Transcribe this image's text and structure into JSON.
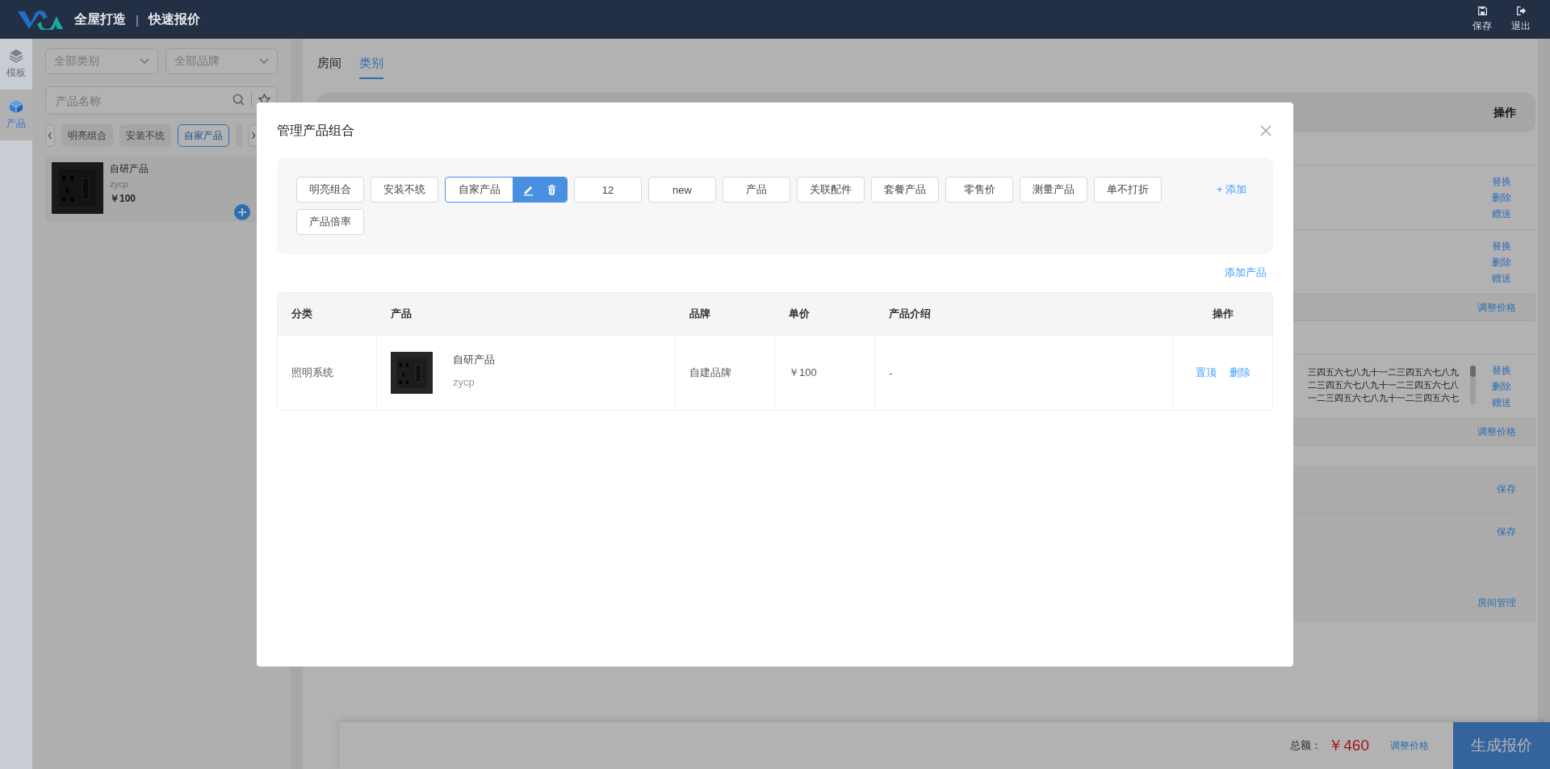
{
  "header": {
    "brand": "全屋打造",
    "separator": "|",
    "page_title": "快速报价",
    "actions": [
      {
        "kind": "save",
        "label": "保存"
      },
      {
        "kind": "exit",
        "label": "退出"
      }
    ]
  },
  "rail": [
    {
      "kind": "layers",
      "label": "模板",
      "selected": false
    },
    {
      "kind": "cube",
      "label": "产品",
      "selected": true
    }
  ],
  "product_panel": {
    "category_select": {
      "placeholder": "全部类别"
    },
    "brand_select": {
      "placeholder": "全部品牌"
    },
    "search": {
      "placeholder": "产品名称"
    },
    "groups": [
      {
        "label": "明亮组合",
        "selected": false
      },
      {
        "label": "安装不统",
        "selected": false
      },
      {
        "label": "自家产品",
        "selected": true
      }
    ],
    "products": [
      {
        "name": "自研产品",
        "code": "zycp",
        "price": "￥100"
      }
    ]
  },
  "main": {
    "tabs": [
      {
        "label": "房间",
        "selected": false
      },
      {
        "label": "类别",
        "selected": true
      }
    ],
    "table_header": {
      "actions": "操作"
    },
    "sections": [
      {
        "rows": [
          {
            "actions": [
              "替换",
              "删除",
              "赠送"
            ]
          },
          {
            "actions": [
              "替换",
              "删除",
              "赠送"
            ]
          }
        ],
        "footer_link": "调整价格"
      },
      {
        "rows": [
          {
            "description_lines": [
              "三四五六七八九十一二三四五六七八九",
              "二三四五六七八九十一二三四五六七八",
              "一二三四五六七八九十一二三四五六七"
            ],
            "actions": [
              "替换",
              "删除",
              "赠送"
            ]
          }
        ],
        "footer_link": "调整价格"
      }
    ],
    "room_panel": {
      "save_links": [
        "保存",
        "保存"
      ],
      "manage_link": "房间管理"
    }
  },
  "footer": {
    "total_label": "总额：",
    "total": "￥460",
    "adjust_link": "调整价格",
    "generate_button": "生成报价"
  },
  "modal": {
    "title": "管理产品组合",
    "groups": [
      {
        "label": "明亮组合",
        "selected": false
      },
      {
        "label": "安装不统",
        "selected": false
      },
      {
        "label": "自家产品",
        "selected": true
      },
      {
        "label": "12",
        "selected": false
      },
      {
        "label": "new",
        "selected": false
      },
      {
        "label": "产品",
        "selected": false
      },
      {
        "label": "关联配件",
        "selected": false
      },
      {
        "label": "套餐产品",
        "selected": false
      },
      {
        "label": "零售价",
        "selected": false
      },
      {
        "label": "测量产品",
        "selected": false
      },
      {
        "label": "单不打折",
        "selected": false
      },
      {
        "label": "产品倍率",
        "selected": false
      }
    ],
    "add_group": "+ 添加",
    "add_product": "添加产品",
    "table": {
      "columns": [
        "分类",
        "产品",
        "品牌",
        "单价",
        "产品介绍",
        "操作"
      ],
      "rows": [
        {
          "category": "照明系统",
          "product": {
            "name": "自研产品",
            "code": "zycp"
          },
          "brand": "自建品牌",
          "price": "￥100",
          "description": "-",
          "actions": [
            "置顶",
            "删除"
          ]
        }
      ]
    }
  }
}
